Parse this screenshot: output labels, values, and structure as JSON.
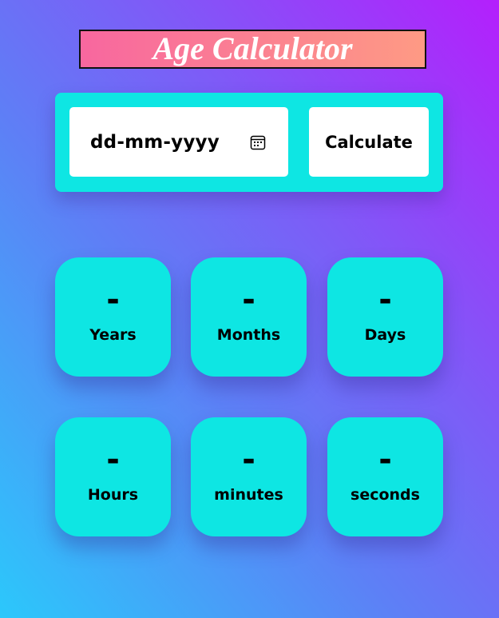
{
  "header": {
    "title": "Age Calculator"
  },
  "input": {
    "date_placeholder": "dd-mm-yyyy",
    "calendar_icon": "calendar-icon",
    "calculate_label": "Calculate"
  },
  "results": [
    {
      "value": "-",
      "label": "Years"
    },
    {
      "value": "-",
      "label": "Months"
    },
    {
      "value": "-",
      "label": "Days"
    },
    {
      "value": "-",
      "label": "Hours"
    },
    {
      "value": "-",
      "label": "minutes"
    },
    {
      "value": "-",
      "label": "seconds"
    }
  ],
  "colors": {
    "card": "#0ee6e3",
    "title_gradient_start": "#f8679f",
    "title_gradient_end": "#fe9a84",
    "bg_top": "#b41ffc",
    "bg_bottom": "#2bc8fb"
  }
}
